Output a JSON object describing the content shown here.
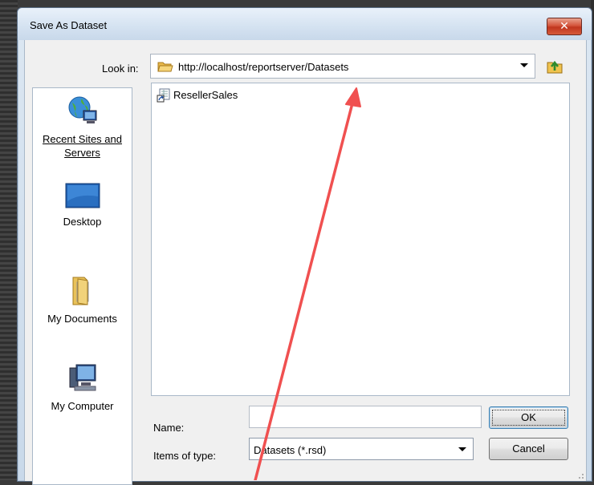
{
  "dialog": {
    "title": "Save As Dataset",
    "close_label": "✕"
  },
  "lookin": {
    "label": "Look in:",
    "path": "http://localhost/reportserver/Datasets"
  },
  "places": [
    {
      "label": "Recent Sites and Servers",
      "icon": "globe-computer-icon"
    },
    {
      "label": "Desktop",
      "icon": "desktop-icon"
    },
    {
      "label": "My Documents",
      "icon": "folder-documents-icon"
    },
    {
      "label": "My Computer",
      "icon": "computer-icon"
    }
  ],
  "files": [
    {
      "name": "ResellerSales",
      "icon": "shared-dataset-icon"
    }
  ],
  "form": {
    "name_label": "Name:",
    "name_value": "",
    "type_label": "Items of type:",
    "type_value": "Datasets (*.rsd)"
  },
  "buttons": {
    "ok": "OK",
    "cancel": "Cancel"
  },
  "colors": {
    "annotation_arrow": "#f05050",
    "close_button": "#c8452b"
  }
}
